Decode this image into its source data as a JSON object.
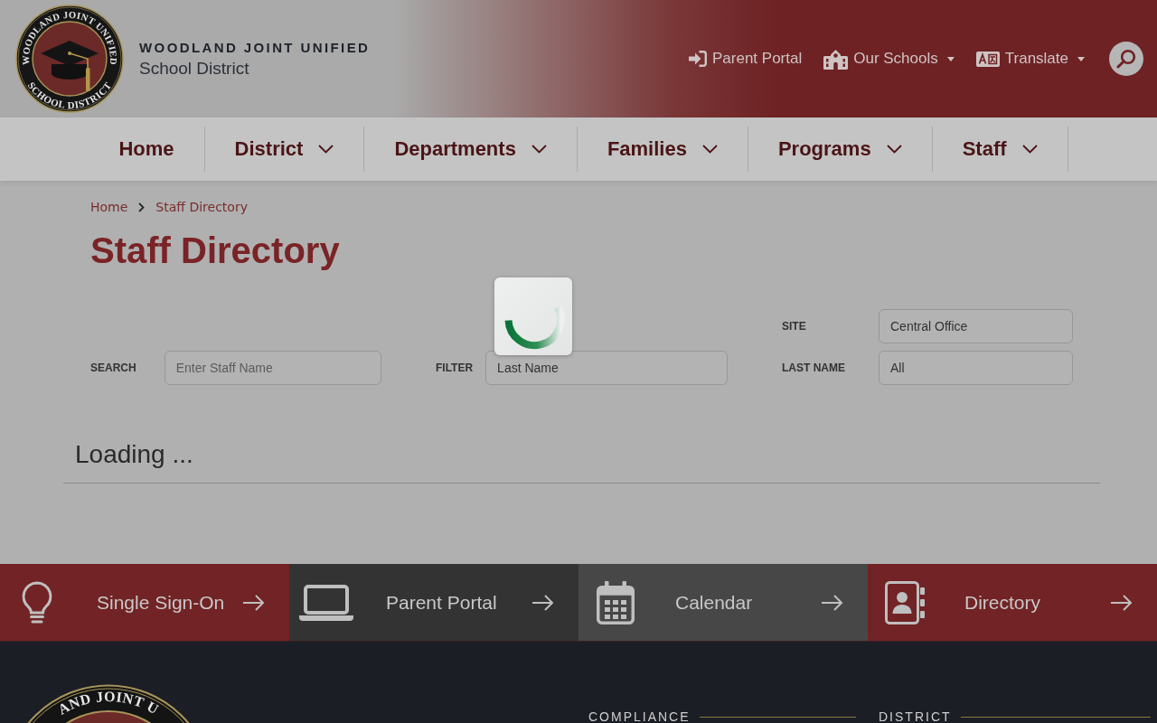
{
  "header": {
    "seal": {
      "ring_top": "WOODLAND JOINT UNIFIED",
      "ring_bottom": "SCHOOL DISTRICT"
    },
    "district_name": "WOODLAND JOINT UNIFIED",
    "district_subtitle": "School District",
    "utility_links": [
      {
        "kind": "link",
        "label": "Parent Portal"
      },
      {
        "kind": "dropdown",
        "label": "Our Schools"
      },
      {
        "kind": "dropdown",
        "label": "Translate"
      }
    ]
  },
  "nav": {
    "items": [
      {
        "label": "Home",
        "has_submenu": false
      },
      {
        "label": "District",
        "has_submenu": true
      },
      {
        "label": "Departments",
        "has_submenu": true
      },
      {
        "label": "Families",
        "has_submenu": true
      },
      {
        "label": "Programs",
        "has_submenu": true
      },
      {
        "label": "Staff",
        "has_submenu": true
      }
    ]
  },
  "breadcrumb": [
    "Home",
    "Staff Directory"
  ],
  "page_title": "Staff Directory",
  "filters": {
    "columns": [
      [
        {
          "label": "SEARCH",
          "placeholder": "Enter Staff Name"
        }
      ],
      [
        {
          "label": "FILTER",
          "value": "Last Name"
        }
      ],
      [
        {
          "label": "SITE",
          "value": "Central Office"
        },
        {
          "label": "LAST NAME",
          "value": "All"
        }
      ]
    ]
  },
  "status": "Loading ...",
  "quick_links": [
    {
      "label": "Single Sign-On",
      "color": "#722325"
    },
    {
      "label": "Parent Portal",
      "color": "#333333"
    },
    {
      "label": "Calendar",
      "color": "#474747"
    },
    {
      "label": "Directory",
      "color": "#722325"
    }
  ],
  "footer": {
    "seal_text": "AND JOINT U",
    "headings": [
      "COMPLIANCE",
      "DISTRICT"
    ]
  }
}
